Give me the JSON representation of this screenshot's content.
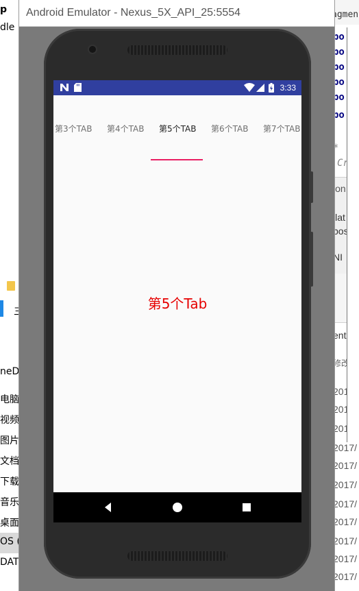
{
  "window": {
    "title": "Android Emulator - Nexus_5X_API_25:5554"
  },
  "status_bar": {
    "time": "3:33",
    "icons": [
      "n-notification-icon",
      "sd-card-icon",
      "wifi-icon",
      "signal-icon",
      "battery-icon"
    ],
    "color": "#303f9f"
  },
  "tabs": {
    "items": [
      {
        "label": "第3个TAB"
      },
      {
        "label": "第4个TAB"
      },
      {
        "label": "第5个TAB"
      },
      {
        "label": "第6个TAB"
      },
      {
        "label": "第7个TAB"
      }
    ],
    "selected": "第5个TAB",
    "indicator_color": "#e91e63"
  },
  "content": {
    "text": "第5个Tab",
    "color": "#e60000"
  },
  "nav_bar": {
    "buttons": [
      "back-icon",
      "home-icon",
      "recents-icon"
    ]
  },
  "background": {
    "left_fragments": [
      "p",
      "dle",
      "三",
      "neD",
      "电脑",
      "视频",
      "图片",
      "文档",
      "下载",
      "音乐",
      "桌面",
      "OS (",
      "DAT"
    ],
    "right_fragments": [
      "agmen",
      "po",
      "po",
      "po",
      "po",
      "po",
      "po",
      "*",
      "Cr",
      "ion",
      "llat",
      "pos",
      "NI",
      "ent",
      "修改",
      "2017/",
      "2017/",
      "2017/",
      "2017/",
      "2017/",
      "2017/",
      "2017/",
      "2017/",
      "2017/",
      "2017/",
      "2017/",
      "2017/"
    ]
  }
}
